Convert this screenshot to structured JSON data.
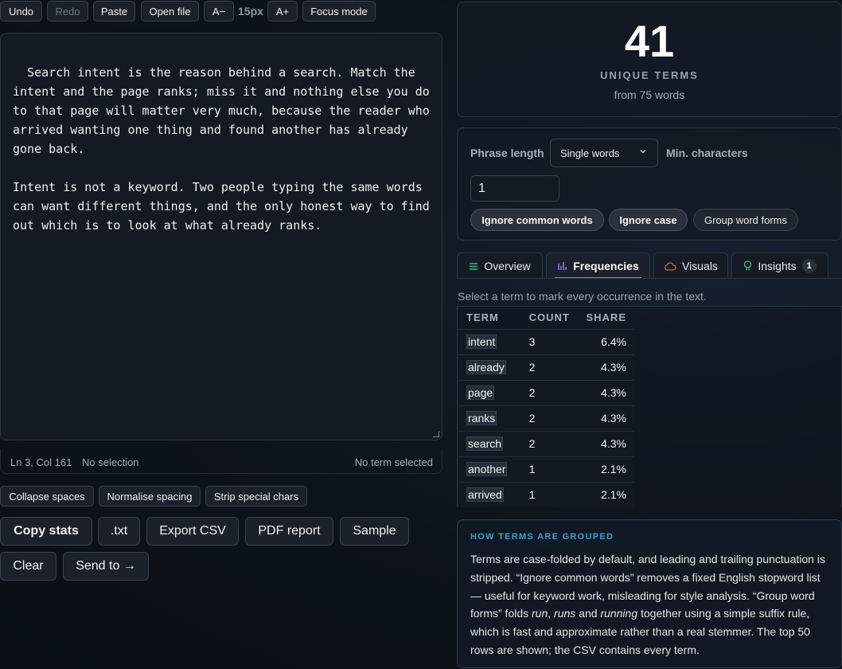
{
  "toolbar": {
    "undo": "Undo",
    "redo": "Redo",
    "paste": "Paste",
    "open_file": "Open file",
    "font_down": "A−",
    "font_size": "15px",
    "font_up": "A+",
    "focus_mode": "Focus mode"
  },
  "editor": {
    "text": "Search intent is the reason behind a search. Match the intent and the page ranks; miss it and nothing else you do to that page will matter very much, because the reader who arrived wanting one thing and found another has already gone back.\n\nIntent is not a keyword. Two people typing the same words can want different things, and the only honest way to find out which is to look at what already ranks."
  },
  "status": {
    "position": "Ln 3, Col 161",
    "selection": "No selection",
    "term": "No term selected"
  },
  "cleanup": {
    "collapse": "Collapse spaces",
    "normalise": "Normalise spacing",
    "strip": "Strip special chars"
  },
  "actions": {
    "copy_stats": "Copy stats",
    "txt": ".txt",
    "export_csv": "Export CSV",
    "pdf_report": "PDF report",
    "sample": "Sample",
    "clear": "Clear",
    "send_to": "Send to →"
  },
  "summary": {
    "count": "41",
    "label": "UNIQUE TERMS",
    "sub": "from 75 words"
  },
  "controls": {
    "phrase_length_label": "Phrase length",
    "phrase_length_value": "Single words",
    "min_chars_label": "Min. characters",
    "min_chars_value": "1",
    "chips": [
      "Ignore common words",
      "Ignore case",
      "Group word forms"
    ]
  },
  "tabs": [
    {
      "label": "Overview",
      "icon": "list-icon"
    },
    {
      "label": "Frequencies",
      "icon": "bar-chart-icon"
    },
    {
      "label": "Visuals",
      "icon": "cloud-icon"
    },
    {
      "label": "Insights",
      "icon": "lightbulb-icon",
      "badge": "1"
    }
  ],
  "hint": "Select a term to mark every occurrence in the text.",
  "table": {
    "headers": [
      "TERM",
      "COUNT",
      "SHARE"
    ],
    "rows": [
      [
        "intent",
        "3",
        "6.4%"
      ],
      [
        "already",
        "2",
        "4.3%"
      ],
      [
        "page",
        "2",
        "4.3%"
      ],
      [
        "ranks",
        "2",
        "4.3%"
      ],
      [
        "search",
        "2",
        "4.3%"
      ],
      [
        "another",
        "1",
        "2.1%"
      ],
      [
        "arrived",
        "1",
        "2.1%"
      ]
    ]
  },
  "info": {
    "title": "HOW TERMS ARE GROUPED",
    "p1": "Terms are case-folded by default, and leading and trailing punctuation is stripped. “Ignore common words” removes a fixed English stopword list — useful for keyword work, misleading for style analysis. “Group word forms” folds ",
    "w1": "run",
    "s1": ", ",
    "w2": "runs",
    "s2": " and ",
    "w3": "running",
    "p2": " together using a simple suffix rule, which is fast and approximate rather than a real stemmer. The top 50 rows are shown; the CSV contains every term."
  },
  "colors": {
    "accent_blue": "#3aa0d4",
    "accent_purple": "#8b6ff0",
    "background": "#0d131c"
  }
}
